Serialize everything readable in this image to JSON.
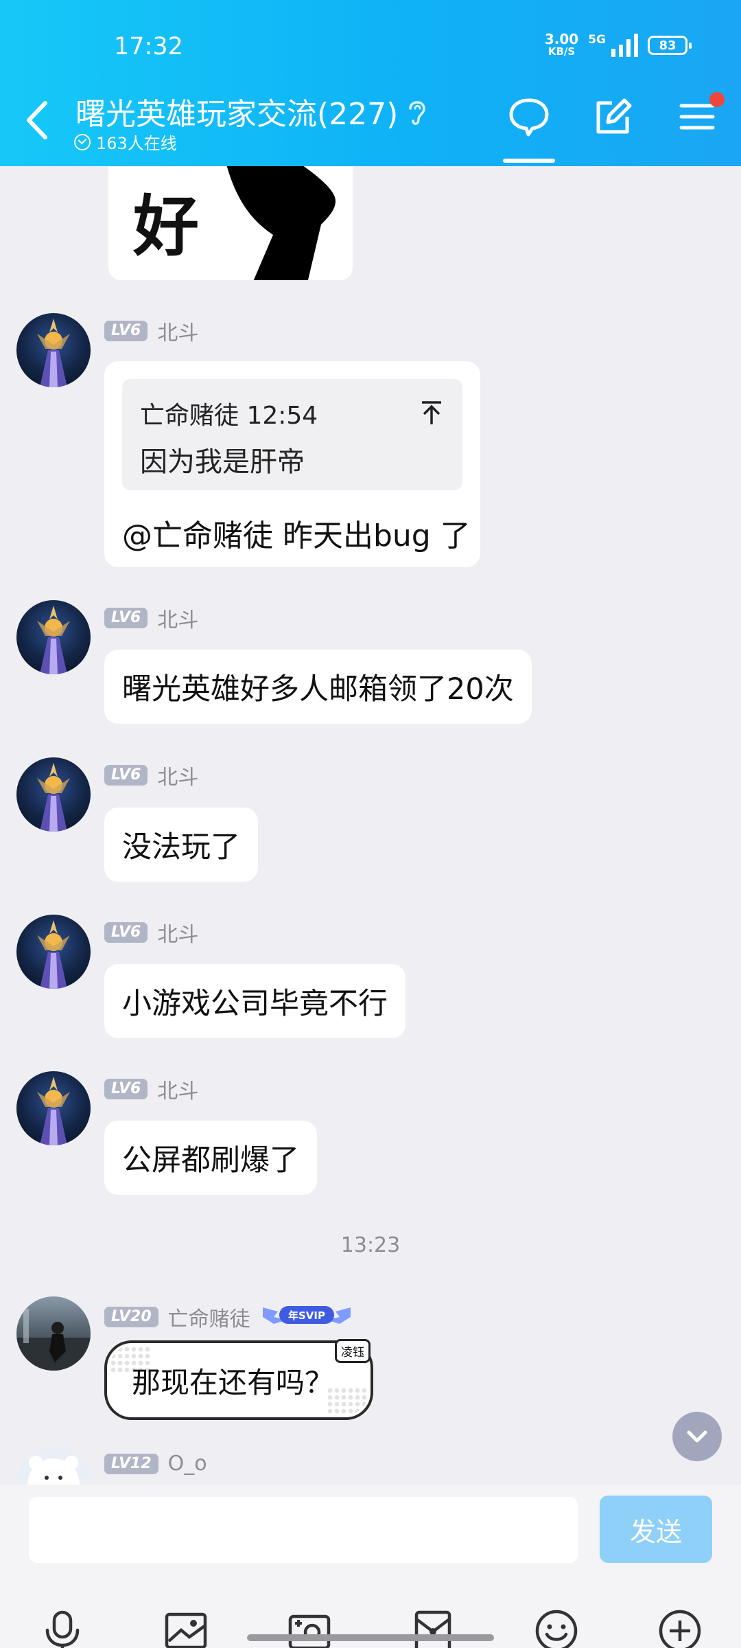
{
  "status": {
    "time": "17:32",
    "net_speed": "3.00",
    "net_unit": "KB/S",
    "network": "5G",
    "battery": "83"
  },
  "header": {
    "title": "曙光英雄玩家交流(227)",
    "online": "163人在线"
  },
  "sticker": {
    "char": "好"
  },
  "messages": [
    {
      "level": "LV6",
      "name": "北斗",
      "quote_author": "亡命赌徒",
      "quote_time": "12:54",
      "quote_text": "因为我是肝帝",
      "text": "@亡命赌徒 昨天出bug 了"
    },
    {
      "level": "LV6",
      "name": "北斗",
      "text": "曙光英雄好多人邮箱领了20次"
    },
    {
      "level": "LV6",
      "name": "北斗",
      "text": "没法玩了"
    },
    {
      "level": "LV6",
      "name": "北斗",
      "text": "小游戏公司毕竟不行"
    },
    {
      "level": "LV6",
      "name": "北斗",
      "text": "公屏都刷爆了"
    }
  ],
  "time_divider": "13:23",
  "special_message": {
    "level": "LV20",
    "name": "亡命赌徒",
    "badge": "年SVIP",
    "bubble_tag": "凌钰",
    "text": "那现在还有吗？"
  },
  "partial_message": {
    "level": "LV12",
    "name": "O_o"
  },
  "input": {
    "placeholder": "",
    "send_label": "发送"
  },
  "toolbar": [
    "microphone-icon",
    "image-icon",
    "camera-icon",
    "red-packet-icon",
    "emoji-icon",
    "plus-icon"
  ],
  "colors": {
    "header": "#16c8f8",
    "send_button": "#8ed0f8",
    "level_badge": "#b1b6c7",
    "background": "#efeff3"
  }
}
